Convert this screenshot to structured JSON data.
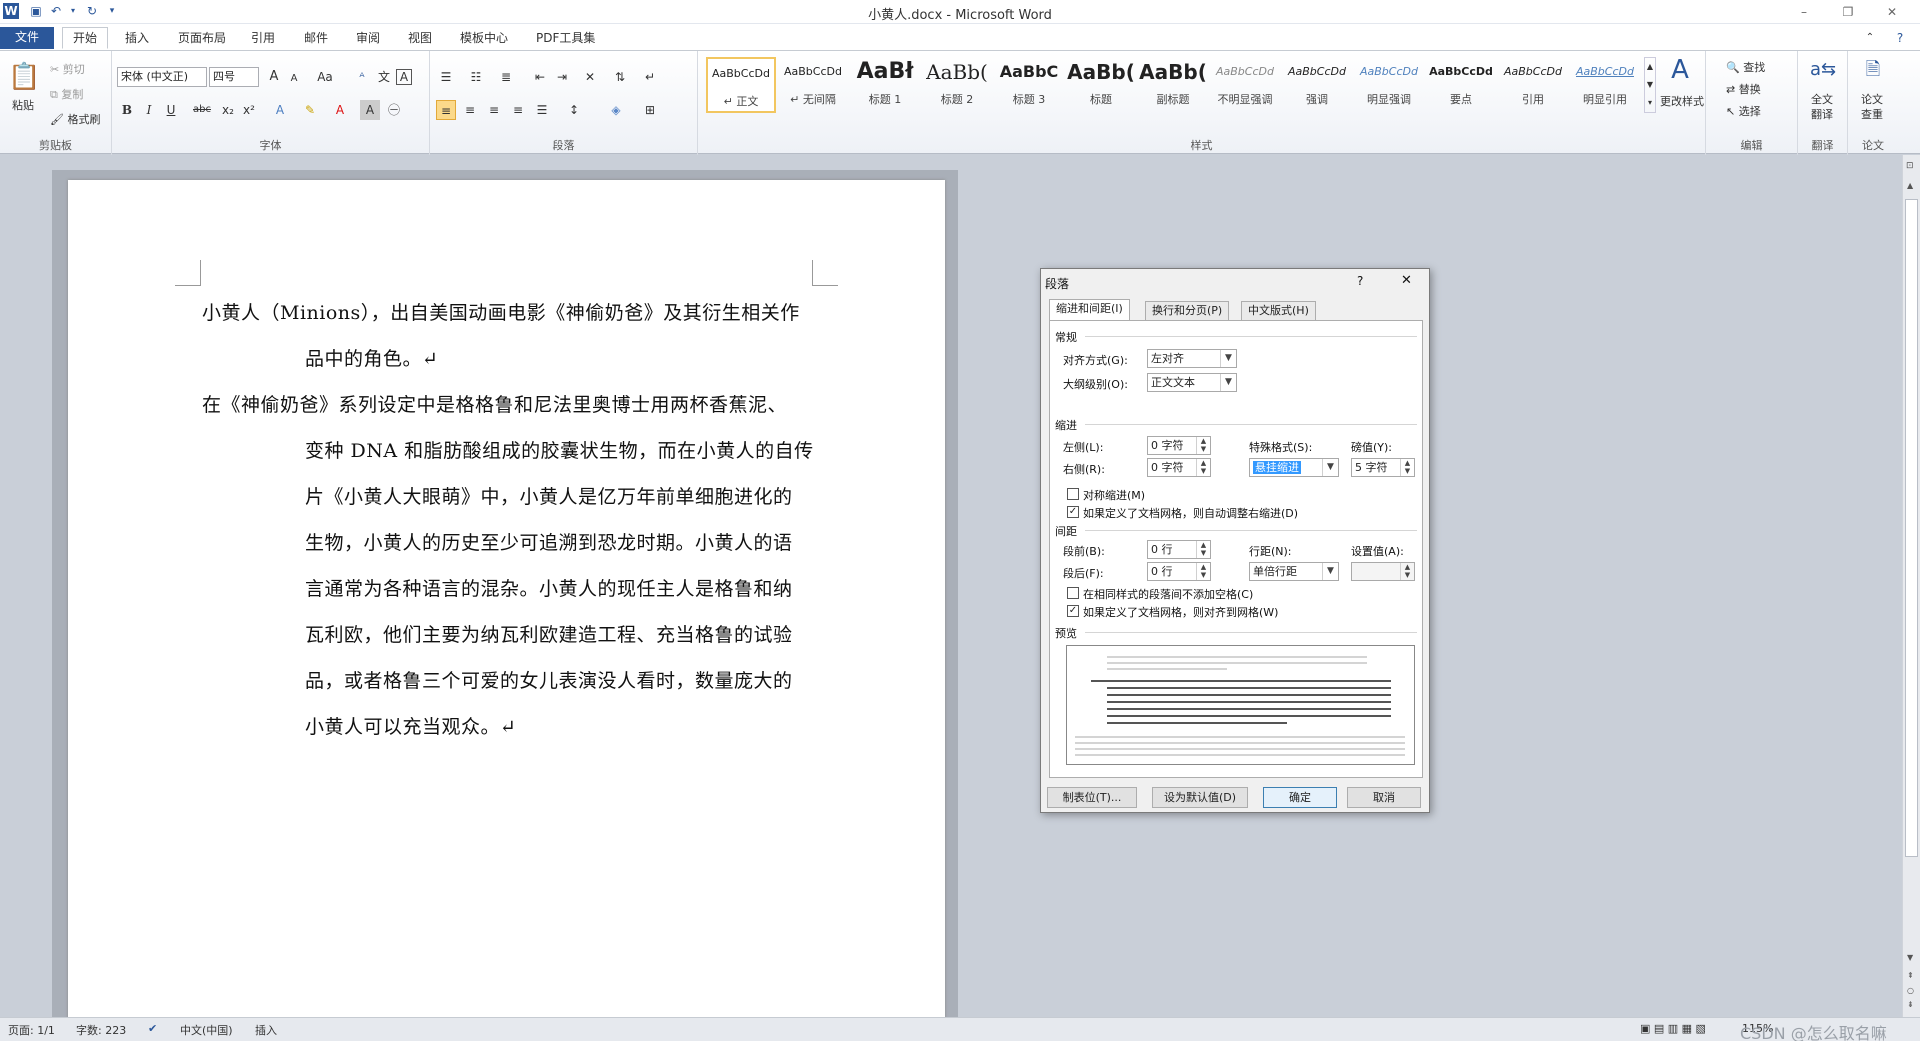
{
  "window": {
    "title": "小黄人.docx - Microsoft Word",
    "minimize": "–",
    "restore": "❐",
    "close": "✕"
  },
  "tabs": [
    "文件",
    "开始",
    "插入",
    "页面布局",
    "引用",
    "邮件",
    "审阅",
    "视图",
    "模板中心",
    "PDF工具集"
  ],
  "ribbon": {
    "clipboard": {
      "label": "剪贴板",
      "paste": "粘贴",
      "cut": "剪切",
      "copy": "复制",
      "format_painter": "格式刷"
    },
    "font": {
      "label": "字体",
      "font_name": "宋体 (中文正)",
      "font_size": "四号",
      "bold": "B",
      "italic": "I",
      "underline": "U",
      "strike": "abc",
      "sub": "x₂",
      "sup": "x²",
      "case": "Aa",
      "grow": "A",
      "shrink": "A"
    },
    "paragraph": {
      "label": "段落"
    },
    "styles": {
      "label": "样式",
      "items": [
        {
          "preview": "AaBbCcDd",
          "name": "↵ 正文"
        },
        {
          "preview": "AaBbCcDd",
          "name": "↵ 无间隔"
        },
        {
          "preview": "AaBł",
          "name": "标题 1"
        },
        {
          "preview": "AaBb(",
          "name": "标题 2"
        },
        {
          "preview": "AaBbC",
          "name": "标题 3"
        },
        {
          "preview": "AaBb(",
          "name": "标题"
        },
        {
          "preview": "AaBb(",
          "name": "副标题"
        },
        {
          "preview": "AaBbCcDd",
          "name": "不明显强调"
        },
        {
          "preview": "AaBbCcDd",
          "name": "强调"
        },
        {
          "preview": "AaBbCcDd",
          "name": "明显强调"
        },
        {
          "preview": "AaBbCcDd",
          "name": "要点"
        },
        {
          "preview": "AaBbCcDd",
          "name": "引用"
        },
        {
          "preview": "AaBbCcDd",
          "name": "明显引用"
        }
      ],
      "change_styles": "更改样式"
    },
    "editing": {
      "label": "编辑",
      "find": "查找",
      "replace": "替换",
      "select": "选择"
    },
    "translate": {
      "label": "翻译",
      "full": "全文",
      "full2": "翻译"
    },
    "paper": {
      "label": "论文",
      "check": "论文",
      "check2": "查重"
    }
  },
  "document": {
    "lines": [
      "小黄人（Minions），出自美国动画电影《神偷奶爸》及其衍生相关作",
      "品中的角色。↵",
      "在《神偷奶爸》系列设定中是格格鲁和尼法里奥博士用两杯香蕉泥、",
      "变种 DNA 和脂肪酸组成的胶囊状生物，而在小黄人的自传",
      "片《小黄人大眼萌》中，小黄人是亿万年前单细胞进化的",
      "生物，小黄人的历史至少可追溯到恐龙时期。小黄人的语",
      "言通常为各种语言的混杂。小黄人的现任主人是格鲁和纳",
      "瓦利欧，他们主要为纳瓦利欧建造工程、充当格鲁的试验",
      "品，或者格鲁三个可爱的女儿表演没人看时，数量庞大的",
      "小黄人可以充当观众。↵"
    ]
  },
  "dialog": {
    "title": "段落",
    "help": "?",
    "close": "✕",
    "tabs": [
      "缩进和间距(I)",
      "换行和分页(P)",
      "中文版式(H)"
    ],
    "general": "常规",
    "alignment_label": "对齐方式(G):",
    "alignment_value": "左对齐",
    "outline_label": "大纲级别(O):",
    "outline_value": "正文文本",
    "indent": "缩进",
    "left_label": "左侧(L):",
    "left_value": "0 字符",
    "right_label": "右侧(R):",
    "right_value": "0 字符",
    "special_label": "特殊格式(S):",
    "special_value": "悬挂缩进",
    "measure_label": "磅值(Y):",
    "measure_value": "5 字符",
    "mirror": "对称缩进(M)",
    "auto_adjust": "如果定义了文档网格，则自动调整右缩进(D)",
    "spacing": "间距",
    "before_label": "段前(B):",
    "before_value": "0 行",
    "after_label": "段后(F):",
    "after_value": "0 行",
    "line_label": "行距(N):",
    "line_value": "单倍行距",
    "at_label": "设置值(A):",
    "at_value": "",
    "no_space": "在相同样式的段落间不添加空格(C)",
    "snap_grid": "如果定义了文档网格，则对齐到网格(W)",
    "preview": "预览",
    "btn_tabs": "制表位(T)...",
    "btn_default": "设为默认值(D)",
    "btn_ok": "确定",
    "btn_cancel": "取消",
    "mirror_checked": false,
    "auto_checked": true,
    "no_space_checked": false,
    "snap_checked": true
  },
  "status": {
    "page": "页面: 1/1",
    "words": "字数: 223",
    "lang": "中文(中国)",
    "mode": "插入",
    "zoom": "115%",
    "watermark": "CSDN @怎么取名嘛"
  }
}
